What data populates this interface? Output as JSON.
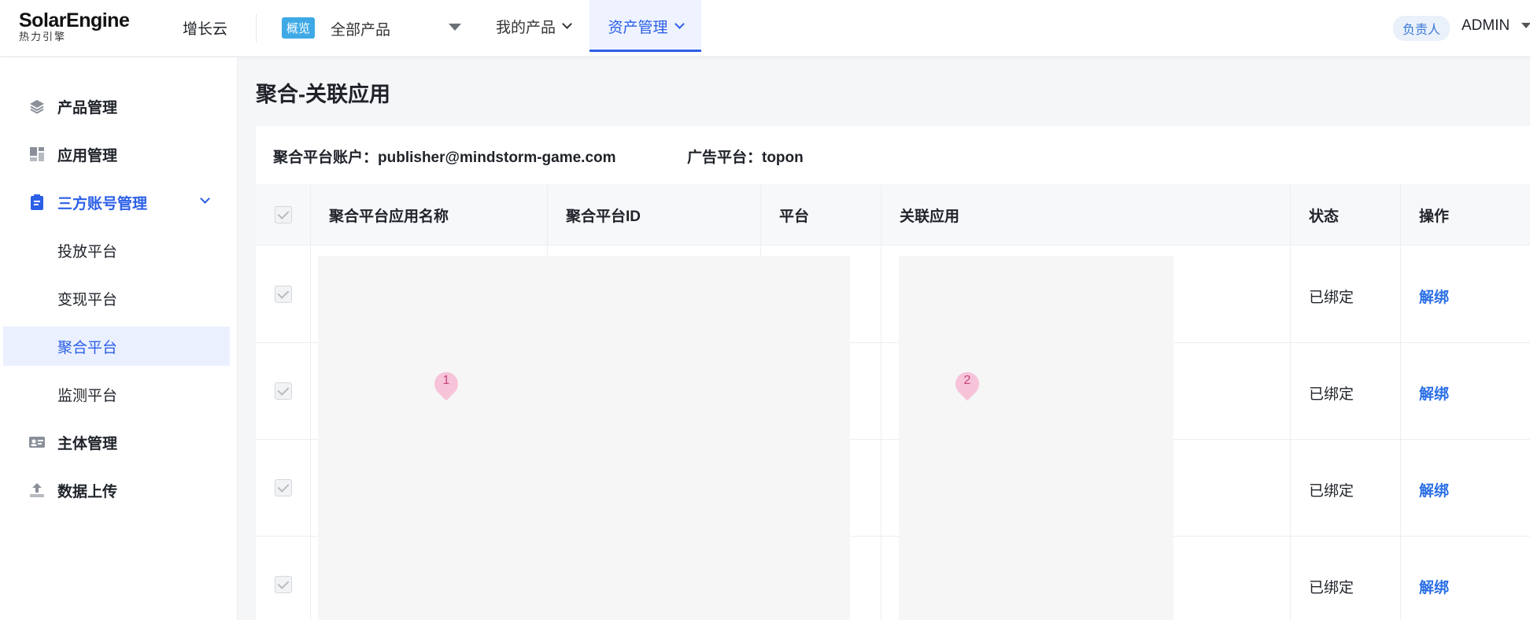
{
  "header": {
    "logo_main": "SolarEngine",
    "logo_sub": "热力引擎",
    "app_name": "增长云",
    "product_tag": "概览",
    "product_select": "全部产品",
    "nav_my_products": "我的产品",
    "nav_asset_mgmt": "资产管理",
    "role_badge": "负责人",
    "user": "ADMIN"
  },
  "sidebar": {
    "items": [
      {
        "label": "产品管理",
        "icon": "layers-icon"
      },
      {
        "label": "应用管理",
        "icon": "grid-icon"
      },
      {
        "label": "三方账号管理",
        "icon": "clipboard-icon"
      },
      {
        "label": "投放平台"
      },
      {
        "label": "变现平台"
      },
      {
        "label": "聚合平台"
      },
      {
        "label": "监测平台"
      },
      {
        "label": "主体管理",
        "icon": "id-card-icon"
      },
      {
        "label": "数据上传",
        "icon": "upload-icon"
      }
    ]
  },
  "main": {
    "title": "聚合-关联应用",
    "filter": {
      "account": "聚合平台账户：publisher@mindstorm-game.com",
      "platform": "广告平台：topon"
    },
    "table": {
      "columns": [
        "聚合平台应用名称",
        "聚合平台ID",
        "平台",
        "关联应用",
        "状态",
        "操作"
      ],
      "rows": [
        {
          "status": "已绑定",
          "action": "解绑"
        },
        {
          "status": "已绑定",
          "action": "解绑"
        },
        {
          "status": "已绑定",
          "action": "解绑"
        },
        {
          "status": "已绑定",
          "action": "解绑"
        }
      ]
    },
    "markers": [
      "1",
      "2"
    ]
  },
  "colors": {
    "accent": "#2b5fe6",
    "active_bg": "#eaf0ff",
    "tag_bg": "#3fa9e6",
    "marker": "#f7c3d8"
  }
}
